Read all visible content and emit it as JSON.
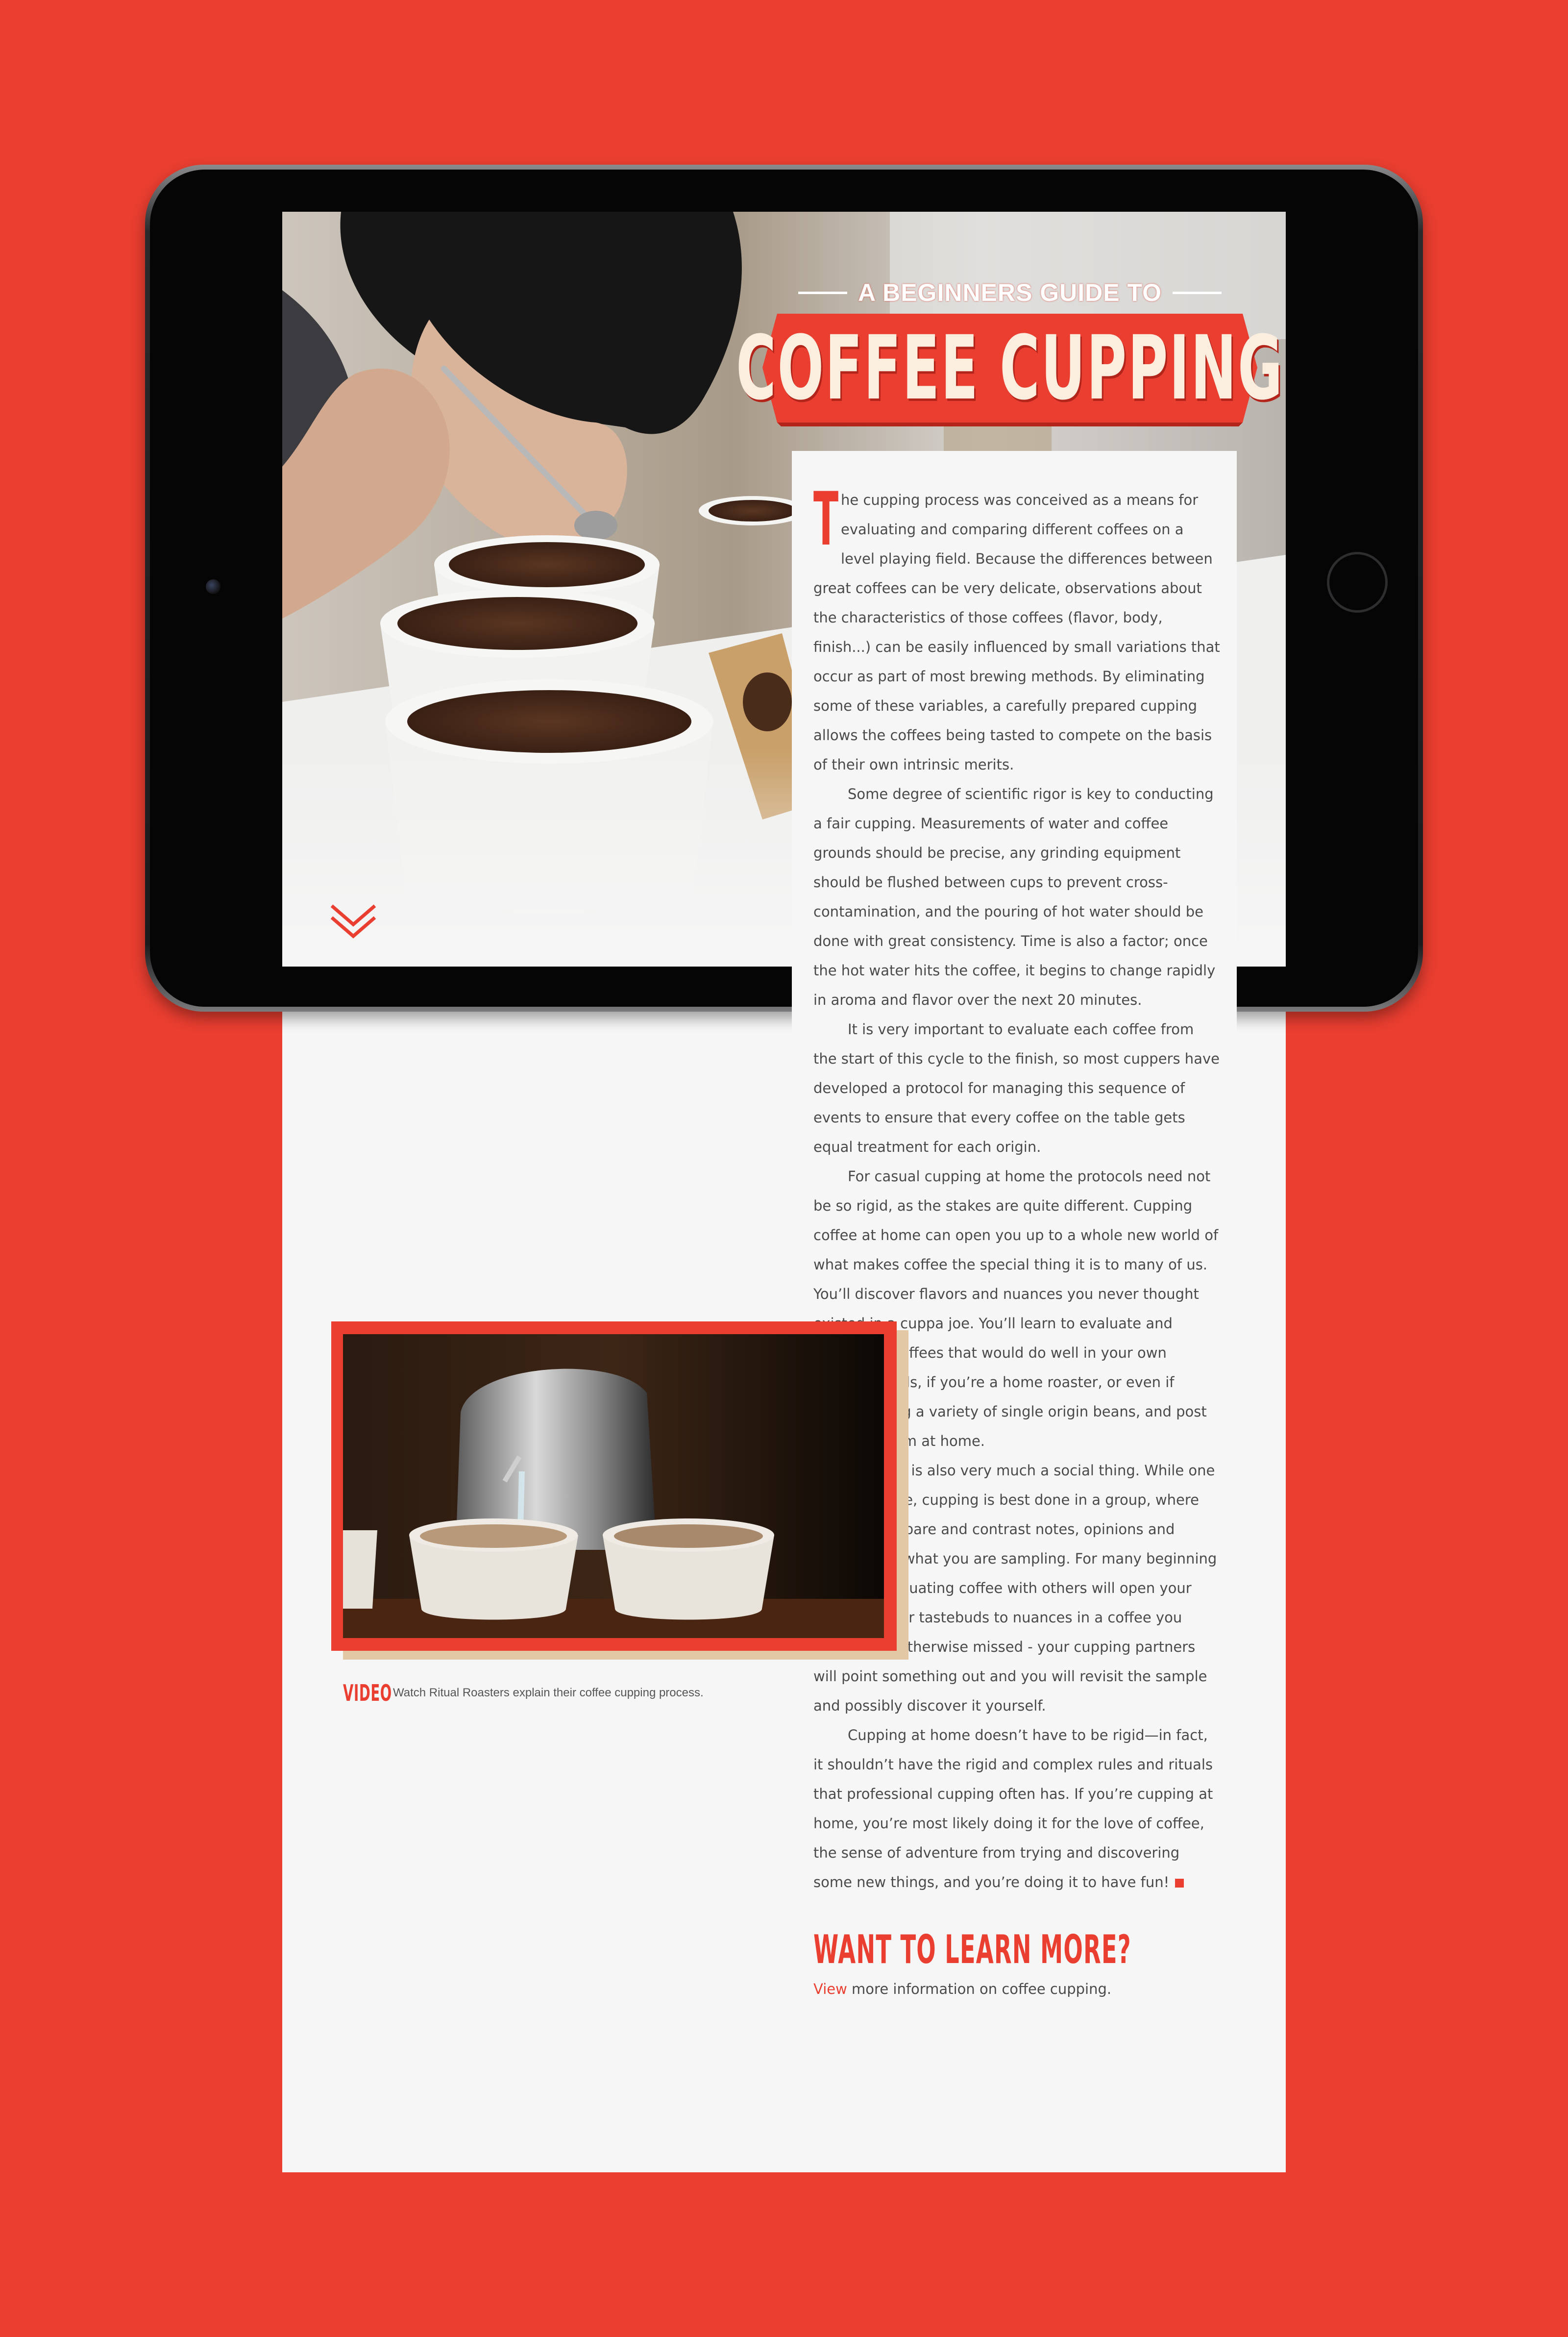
{
  "colors": {
    "background": "#e93e30",
    "accent": "#e93e30",
    "page": "#f6f6f6",
    "body_text": "#4a4a4a"
  },
  "banner": {
    "kicker": "A BEGINNERS GUIDE TO",
    "title": "COFFEE CUPPING"
  },
  "article": {
    "dropcap": "T",
    "paragraphs": [
      "he cupping process was conceived as a means for evaluating and comparing different coffees on a level playing field. Because the differences between great coffees can be very delicate, observations about the characteristics of those coffees (flavor, body, finish...) can be easily influenced by small variations that occur as part of most brewing methods. By eliminating some of these variables, a carefully prepared cupping allows the coffees being tasted to compete on the basis of their own intrinsic merits.",
      "Some degree of scientific rigor is key to conducting a fair cupping. Measurements of water and coffee grounds should be precise, any grinding equipment should be flushed between cups to prevent cross-contamination, and the pouring of hot water should be done with great consistency. Time is also a factor; once the hot water hits the coffee, it begins to change rapidly in aroma and flavor over the next 20 minutes.",
      "It is very important to evaluate each coffee from the start of this cycle to the finish, so most cuppers have developed a protocol for managing this sequence of events to ensure that every coffee on the table gets equal treatment for each origin.",
      "For casual cupping at home the protocols need not be so rigid, as the stakes are quite different. Cupping coffee at home can open you up to a whole new world of what makes coffee the special thing it is to many of us. You’ll discover flavors and nuances you never thought existed in a cuppa joe. You’ll learn to evaluate and categorize coffees that would do well in your own custom blends, if you’re a home roaster, or even if you’re buying a variety of single origin beans, and post blending them at home.",
      "Cupping is also very much a social thing. While one can cup alone, cupping is best done in a group, where you can compare and contrast notes, opinions and thoughts on what you are sampling. For many beginning cuppers, evaluating coffee with others will open your eyes and your tastebuds to nuances in a coffee you might have otherwise missed - your cupping partners will point something out and you will revisit the sample and possibly discover it yourself.",
      "Cupping at home doesn’t have to be rigid—in fact, it shouldn’t have the rigid and complex rules and rituals that professional cupping often has. If you’re cupping at home, you’re most likely doing it for the love of coffee, the sense of adventure from trying and discovering some new things, and you’re doing it to have fun!"
    ],
    "more_heading": "WANT TO LEARN MORE?",
    "more_link": "View",
    "more_text": " more information on coffee cupping."
  },
  "video": {
    "label": "VIDEO",
    "description": "Watch Ritual Roasters explain their coffee cupping process."
  },
  "icons": {
    "scroll": "chevron-down-icon",
    "play": "video-thumbnail"
  }
}
